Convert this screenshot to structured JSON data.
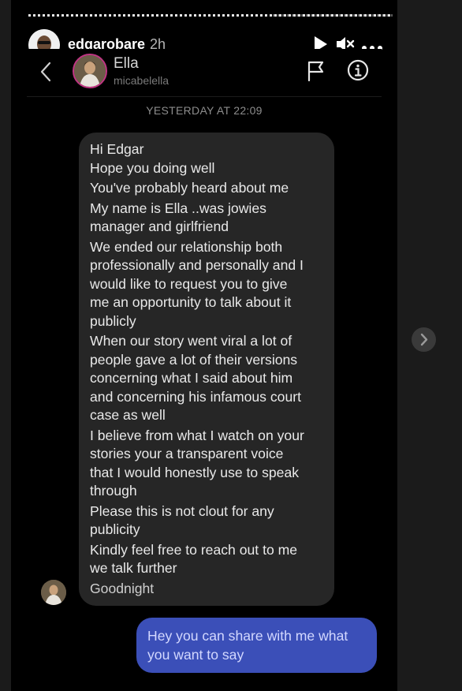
{
  "story": {
    "poster_name": "edgarobare",
    "time_ago": "2h",
    "progress_fraction": 0.67
  },
  "header_icons": [
    "play-icon",
    "mute-icon",
    "more-icon"
  ],
  "dm": {
    "contact_name": "Ella",
    "contact_handle": "micabelella",
    "date_separator": "YESTERDAY AT 22:09",
    "incoming_message": [
      "Hi Edgar",
      "Hope you doing well",
      "You've probably heard about me",
      "My name is Ella ..was jowies",
      "manager and girlfriend",
      "We ended our relationship both",
      "professionally and personally and I",
      "would like to request you to give",
      "me an opportunity to talk about it",
      "publicly",
      "When our story went viral a lot of",
      "people gave a lot of their versions",
      "concerning what I said about him",
      "and concerning his infamous court",
      "case as well",
      "I believe from what I watch on your",
      "stories your a transparent voice",
      "that I would honestly use to speak",
      "through",
      "Please this is not clout for any",
      "publicity",
      "Kindly feel free to reach out to me",
      "we talk further",
      "Goodnight"
    ],
    "outgoing_message": [
      "Hey you can share with me what",
      "you want to say"
    ]
  },
  "colors": {
    "background": "#000000",
    "incoming_bubble": "#262626",
    "outgoing_bubble": "#3b4fb8",
    "story_ring": "#c13584"
  }
}
